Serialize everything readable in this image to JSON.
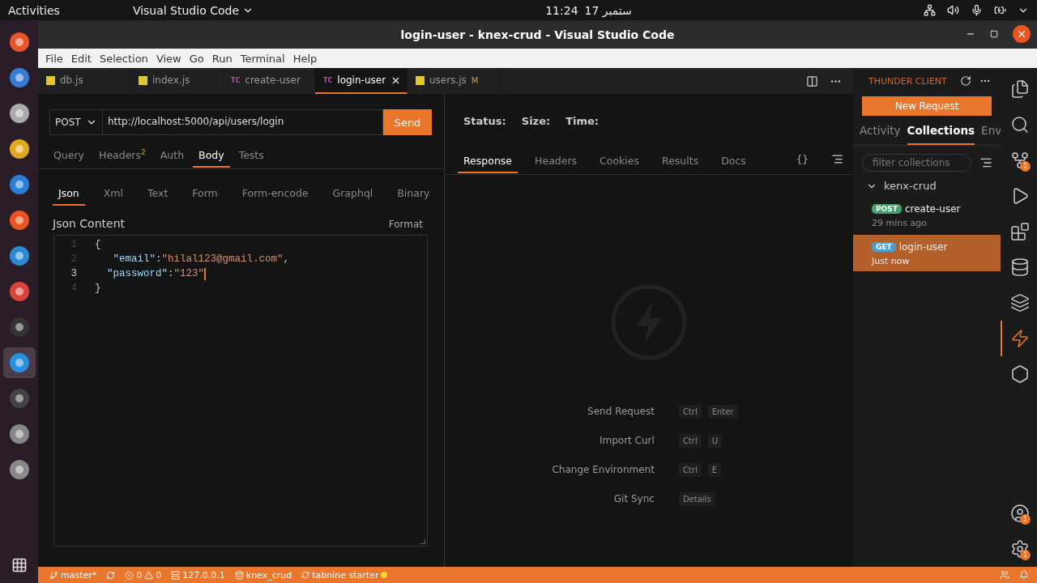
{
  "top_bar": {
    "activities": "Activities",
    "app_menu": "Visual Studio Code",
    "time": "11:24",
    "date": "ستمبر 17"
  },
  "dock": [
    {
      "kind": "firefox",
      "selected": false
    },
    {
      "kind": "mail",
      "selected": false
    },
    {
      "kind": "files",
      "selected": false
    },
    {
      "kind": "music",
      "selected": false
    },
    {
      "kind": "writer",
      "selected": false
    },
    {
      "kind": "store",
      "selected": false
    },
    {
      "kind": "help",
      "selected": false
    },
    {
      "kind": "chrome",
      "selected": false
    },
    {
      "kind": "terminal",
      "selected": false
    },
    {
      "kind": "vscode",
      "selected": true
    },
    {
      "kind": "obs",
      "selected": false
    },
    {
      "kind": "disk",
      "selected": false
    },
    {
      "kind": "disk",
      "selected": false
    }
  ],
  "window": {
    "title": "login-user - knex-crud - Visual Studio Code"
  },
  "menu": [
    "File",
    "Edit",
    "Selection",
    "View",
    "Go",
    "Run",
    "Terminal",
    "Help"
  ],
  "tabs": [
    {
      "label": "db.js",
      "kind": "js",
      "selected": false
    },
    {
      "label": "index.js",
      "kind": "js",
      "selected": false
    },
    {
      "label": "create-user",
      "kind": "tc",
      "icon_text": "TC",
      "selected": false
    },
    {
      "label": "login-user",
      "kind": "tc",
      "icon_text": "TC",
      "selected": true
    },
    {
      "label": "users.js",
      "kind": "js",
      "selected": false,
      "badge": "M"
    }
  ],
  "request": {
    "method": "POST",
    "url": "http://localhost:5000/api/users/login",
    "send": "Send",
    "tabs": [
      {
        "label": "Query",
        "selected": false
      },
      {
        "label": "Headers",
        "count": "2",
        "selected": false
      },
      {
        "label": "Auth",
        "selected": false
      },
      {
        "label": "Body",
        "selected": true
      },
      {
        "label": "Tests",
        "selected": false
      }
    ],
    "body_tabs": [
      {
        "label": "Json",
        "selected": true
      },
      {
        "label": "Xml",
        "selected": false
      },
      {
        "label": "Text",
        "selected": false
      },
      {
        "label": "Form",
        "selected": false
      },
      {
        "label": "Form-encode",
        "selected": false
      },
      {
        "label": "Graphql",
        "selected": false
      },
      {
        "label": "Binary",
        "selected": false
      }
    ],
    "content_title": "Json Content",
    "format": "Format",
    "code": [
      {
        "number": "1",
        "active": false,
        "tokens": [
          {
            "kind": "punct",
            "text": "{"
          }
        ]
      },
      {
        "number": "2",
        "active": false,
        "tokens": [
          {
            "kind": "key",
            "text": "   \"email\""
          },
          {
            "kind": "punct",
            "text": ":"
          },
          {
            "kind": "string",
            "text": "\"hilal123@gmail.com\""
          },
          {
            "kind": "punct",
            "text": ","
          }
        ]
      },
      {
        "number": "3",
        "active": true,
        "tokens": [
          {
            "kind": "key",
            "text": "  \"password\""
          },
          {
            "kind": "punct",
            "text": ":"
          },
          {
            "kind": "string",
            "text": "\"123\""
          }
        ]
      },
      {
        "number": "4",
        "active": false,
        "tokens": [
          {
            "kind": "punct",
            "text": "}"
          }
        ]
      }
    ]
  },
  "response": {
    "status_labels": [
      "Status:",
      "Size:",
      "Time:"
    ],
    "tabs": [
      {
        "label": "Response",
        "selected": true
      },
      {
        "label": "Headers",
        "selected": false
      },
      {
        "label": "Cookies",
        "selected": false
      },
      {
        "label": "Results",
        "selected": false
      },
      {
        "label": "Docs",
        "selected": false
      }
    ],
    "braces": "{}",
    "shortcuts": [
      {
        "label": "Send Request",
        "keys": [
          "Ctrl",
          "Enter"
        ]
      },
      {
        "label": "Import Curl",
        "keys": [
          "Ctrl",
          "U"
        ]
      },
      {
        "label": "Change Environment",
        "keys": [
          "Ctrl",
          "E"
        ]
      },
      {
        "label": "Git Sync",
        "keys": [
          "Details"
        ]
      }
    ]
  },
  "thunder": {
    "title": "THUNDER CLIENT",
    "new_request": "New Request",
    "tabs": [
      {
        "label": "Activity",
        "selected": false
      },
      {
        "label": "Collections",
        "selected": true
      },
      {
        "label": "Env",
        "selected": false
      }
    ],
    "filter_placeholder": "filter collections",
    "collection": {
      "name": "kenx-crud",
      "expanded": true,
      "requests": [
        {
          "method": "POST",
          "name": "create-user",
          "time": "29 mins ago",
          "selected": false,
          "color": "#3fa36a"
        },
        {
          "method": "GET",
          "name": "login-user",
          "time": "Just now",
          "selected": true,
          "color": "#4a9fd4"
        }
      ]
    }
  },
  "activity_bar": [
    {
      "kind": "explorer",
      "selected": false
    },
    {
      "kind": "search",
      "selected": false
    },
    {
      "kind": "source-control",
      "selected": false,
      "badge": "1"
    },
    {
      "kind": "run",
      "selected": false
    },
    {
      "kind": "extensions",
      "selected": false
    },
    {
      "kind": "database",
      "selected": false
    },
    {
      "kind": "layers",
      "selected": false
    },
    {
      "kind": "thunder",
      "selected": true
    },
    {
      "kind": "hexagon",
      "selected": false
    }
  ],
  "activity_bottom": [
    {
      "kind": "account",
      "badge": "1"
    },
    {
      "kind": "settings",
      "badge": "1"
    }
  ],
  "status_bar": {
    "branch": "master*",
    "errors": "0",
    "warnings": "0",
    "host": "127.0.0.1",
    "database": "knex_crud",
    "tabnine": "tabnine starter"
  }
}
